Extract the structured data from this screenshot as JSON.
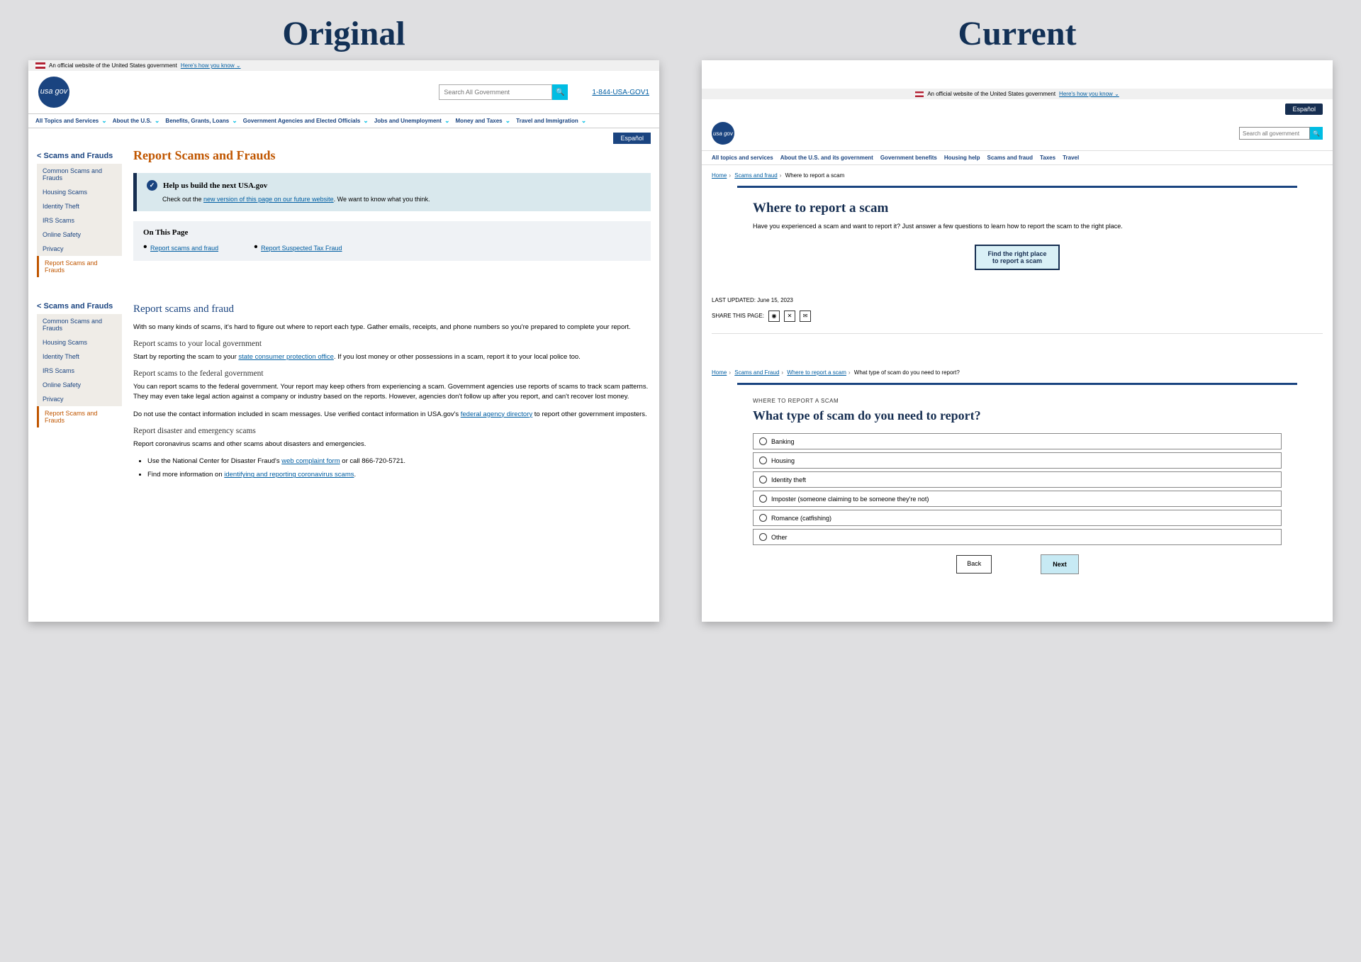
{
  "labels": {
    "original": "Original",
    "current": "Current"
  },
  "original": {
    "banner": {
      "text": "An official website of the United States government",
      "link": "Here's how you know"
    },
    "search": {
      "placeholder": "Search All Government"
    },
    "phone": "1-844-USA-GOV1",
    "logo": "usa gov",
    "nav": [
      "All Topics and Services",
      "About the U.S.",
      "Benefits, Grants, Loans",
      "Government Agencies and Elected Officials",
      "Jobs and Unemployment",
      "Money and Taxes",
      "Travel and Immigration"
    ],
    "espanol": "Español",
    "sidebar": {
      "heading": "< Scams and Frauds",
      "items": [
        "Common Scams and Frauds",
        "Housing Scams",
        "Identity Theft",
        "IRS Scams",
        "Online Safety",
        "Privacy",
        "Report Scams and Frauds"
      ]
    },
    "title": "Report Scams and Frauds",
    "alert": {
      "heading": "Help us build the next USA.gov",
      "pre": "Check out the ",
      "link": "new version of this page on our future website",
      "post": ". We want to know what you think."
    },
    "toc": {
      "heading": "On This Page",
      "links": [
        "Report scams and fraud",
        "Report Suspected Tax Fraud"
      ]
    },
    "h2a": "Report scams and fraud",
    "p1": "With so many kinds of scams, it's hard to figure out where to report each type. Gather emails, receipts, and phone numbers so you're prepared to complete your report.",
    "h3a": "Report scams to your local government",
    "p2_pre": "Start by reporting the scam to your ",
    "p2_link": "state consumer protection office",
    "p2_post": ". If you lost money or other possessions in a scam, report it to your local police too.",
    "h3b": "Report scams to the federal government",
    "p3": "You can report scams to the federal government. Your report may keep others from experiencing a scam. Government agencies use reports of scams to track scam patterns. They may even take legal action against a company or industry based on the reports. However, agencies don't follow up after you report, and can't recover lost money.",
    "p4_pre": "Do not use the contact information included in scam messages. Use verified contact information in USA.gov's ",
    "p4_link": "federal agency directory",
    "p4_post": " to report other government imposters.",
    "h3c": "Report disaster and emergency scams",
    "p5": "Report coronavirus scams and other scams about disasters and emergencies.",
    "li1_pre": "Use the National Center for Disaster Fraud's ",
    "li1_link": "web complaint form",
    "li1_post": " or call 866-720-5721.",
    "li2_pre": "Find more information on ",
    "li2_link": "identifying and reporting coronavirus scams",
    "li2_post": "."
  },
  "current": {
    "banner": {
      "text": "An official website of the United States government",
      "link": "Here's how you know"
    },
    "espanol": "Español",
    "logo": "usa gov",
    "search": {
      "placeholder": "Search all government"
    },
    "nav": [
      "All topics and services",
      "About the U.S. and its government",
      "Government benefits",
      "Housing help",
      "Scams and fraud",
      "Taxes",
      "Travel"
    ],
    "crumb1": {
      "home": "Home",
      "link": "Scams and fraud",
      "current": "Where to report a scam"
    },
    "card1": {
      "title": "Where to report a scam",
      "text": "Have you experienced a scam and want to report it? Just answer a few questions to learn how to report the scam to the right place.",
      "cta": "Find the right place to report a scam"
    },
    "updated_label": "LAST UPDATED: ",
    "updated_value": "June 15, 2023",
    "share_label": "SHARE THIS PAGE:",
    "crumb2": {
      "home": "Home",
      "link1": "Scams and Fraud",
      "link2": "Where to report a scam",
      "current": "What type of scam do you need to report?"
    },
    "card2": {
      "overline": "WHERE TO REPORT A SCAM",
      "question": "What type of scam do you need to report?",
      "options": [
        "Banking",
        "Housing",
        "Identity theft",
        "Imposter (someone claiming to be someone they're not)",
        "Romance (catfishing)",
        "Other"
      ],
      "back": "Back",
      "next": "Next"
    }
  }
}
